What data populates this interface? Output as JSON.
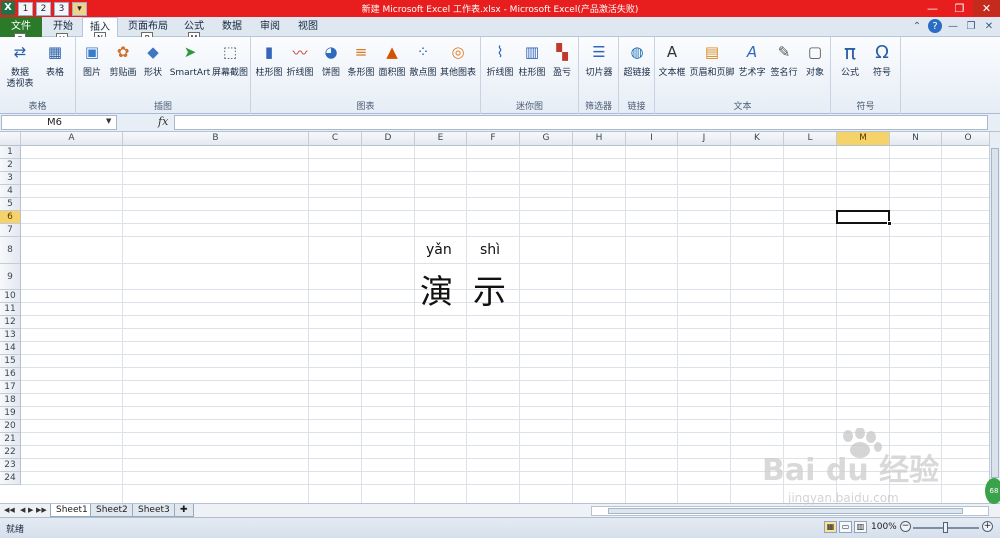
{
  "window": {
    "title": "新建 Microsoft Excel 工作表.xlsx - Microsoft Excel(产品激活失败)",
    "qat_keytips": [
      "1",
      "2",
      "3"
    ],
    "controls": [
      "—",
      "❐",
      "✕"
    ]
  },
  "tabs": [
    {
      "label": "文件",
      "keytip": "F"
    },
    {
      "label": "开始",
      "keytip": "H"
    },
    {
      "label": "插入",
      "keytip": "N"
    },
    {
      "label": "页面布局",
      "keytip": "P"
    },
    {
      "label": "公式",
      "keytip": "M"
    },
    {
      "label": "数据",
      "keytip": ""
    },
    {
      "label": "审阅",
      "keytip": ""
    },
    {
      "label": "视图",
      "keytip": ""
    }
  ],
  "ribbon": {
    "groups": [
      {
        "label": "表格",
        "buttons": [
          "数据\n透视表",
          "表格"
        ]
      },
      {
        "label": "插图",
        "buttons": [
          "图片",
          "剪贴画",
          "形状",
          "SmartArt",
          "屏幕截图"
        ]
      },
      {
        "label": "图表",
        "buttons": [
          "柱形图",
          "折线图",
          "饼图",
          "条形图",
          "面积图",
          "散点图",
          "其他图表"
        ]
      },
      {
        "label": "迷你图",
        "buttons": [
          "折线图",
          "柱形图",
          "盈亏"
        ]
      },
      {
        "label": "筛选器",
        "buttons": [
          "切片器"
        ]
      },
      {
        "label": "链接",
        "buttons": [
          "超链接"
        ]
      },
      {
        "label": "文本",
        "buttons": [
          "文本框",
          "页眉和页脚",
          "艺术字",
          "签名行",
          "对象"
        ]
      },
      {
        "label": "符号",
        "buttons": [
          "公式",
          "符号"
        ]
      }
    ]
  },
  "formula_bar": {
    "name_box": "M6",
    "fx": "fx",
    "value": ""
  },
  "grid": {
    "columns": [
      "A",
      "B",
      "C",
      "D",
      "E",
      "F",
      "G",
      "H",
      "I",
      "J",
      "K",
      "L",
      "M",
      "N",
      "O"
    ],
    "rows": [
      "1",
      "2",
      "3",
      "4",
      "5",
      "6",
      "7",
      "8",
      "9",
      "10",
      "11",
      "12",
      "13",
      "14",
      "15",
      "16",
      "17",
      "18",
      "19",
      "20",
      "21",
      "22",
      "23",
      "24"
    ],
    "selected": "M6",
    "cells": {
      "E8": "yǎn",
      "F8": "shì",
      "E9": "演",
      "F9": "示"
    }
  },
  "sheets": [
    "Sheet1",
    "Sheet2",
    "Sheet3"
  ],
  "status": {
    "text": "就绪",
    "zoom": "100%",
    "zoom_fraction": 0.5
  },
  "watermark": {
    "brand": "Bai du 经验",
    "url": "jingyan.baidu.com",
    "badge": "68"
  }
}
